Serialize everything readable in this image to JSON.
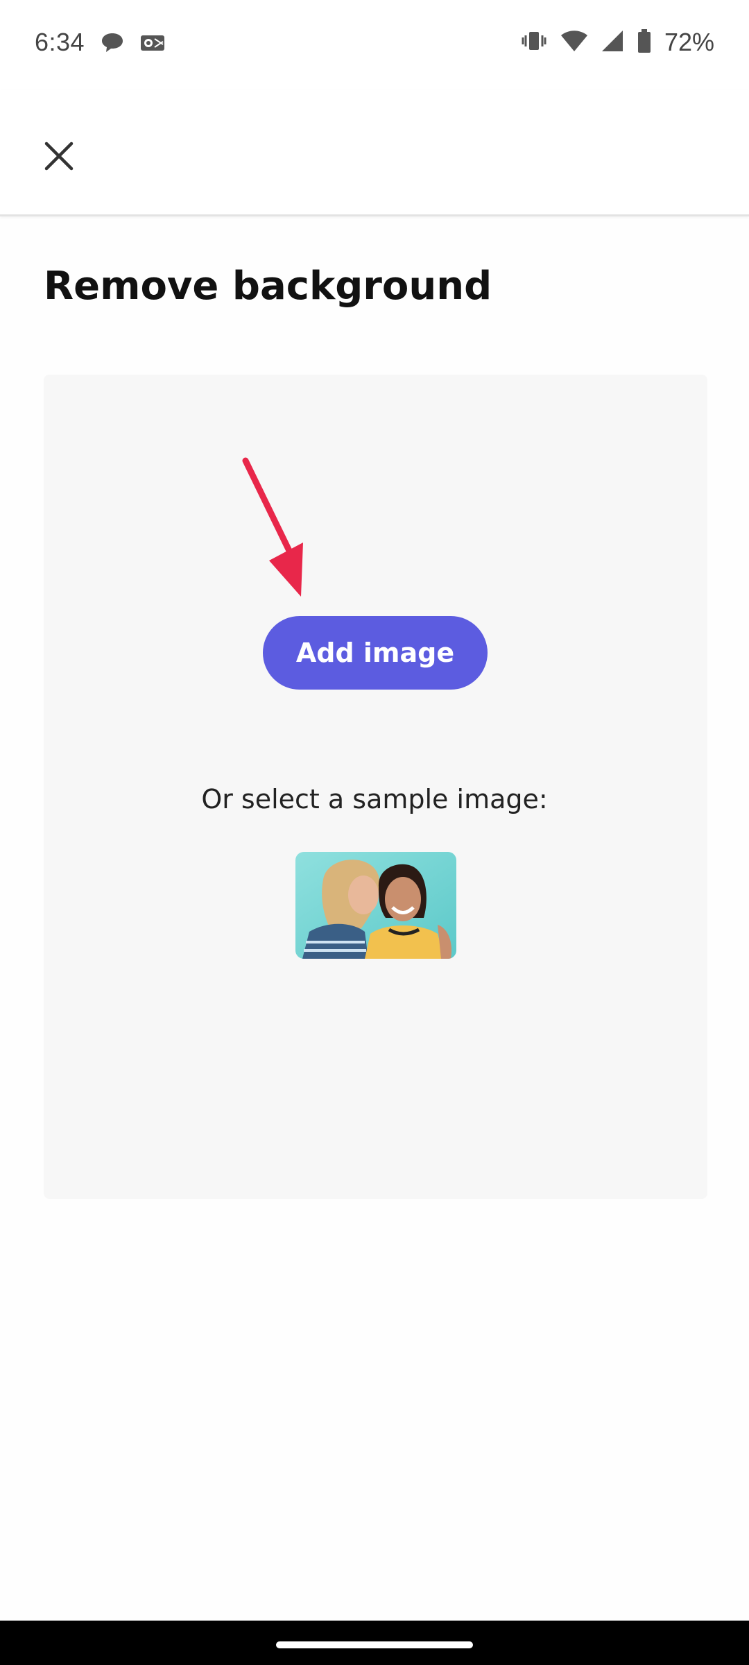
{
  "status_bar": {
    "time": "6:34",
    "battery_text": "72%",
    "icons": [
      "chat-notification-icon",
      "outlook-icon",
      "vibrate-icon",
      "wifi-icon",
      "signal-icon",
      "battery-icon"
    ]
  },
  "app_bar": {
    "close_icon": "close-icon"
  },
  "page": {
    "title": "Remove background"
  },
  "panel": {
    "add_image_label": "Add image",
    "sample_label": "Or select a sample image:",
    "accent_color": "#5c5ce0",
    "annotation_arrow_color": "#e8274a"
  }
}
